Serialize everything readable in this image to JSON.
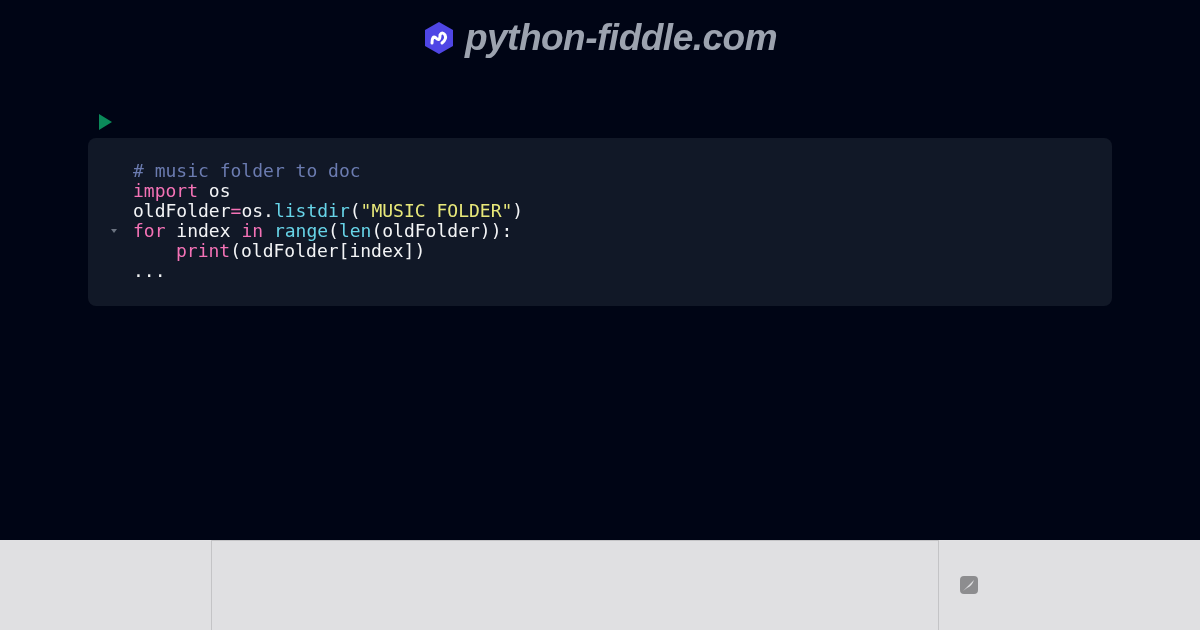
{
  "header": {
    "site_name": "python-fiddle.com"
  },
  "code": {
    "lines": [
      {
        "foldable": false,
        "indented": false,
        "tokens": [
          {
            "kind": "comment",
            "text": "# music folder to doc"
          }
        ]
      },
      {
        "foldable": false,
        "indented": false,
        "tokens": [
          {
            "kind": "keyword",
            "text": "import"
          },
          {
            "kind": "plain",
            "text": " os"
          }
        ]
      },
      {
        "foldable": false,
        "indented": false,
        "tokens": [
          {
            "kind": "plain",
            "text": "oldFolder"
          },
          {
            "kind": "operator",
            "text": "="
          },
          {
            "kind": "plain",
            "text": "os."
          },
          {
            "kind": "function",
            "text": "listdir"
          },
          {
            "kind": "plain",
            "text": "("
          },
          {
            "kind": "string",
            "text": "\"MUSIC FOLDER\""
          },
          {
            "kind": "plain",
            "text": ")"
          }
        ]
      },
      {
        "foldable": true,
        "indented": false,
        "tokens": [
          {
            "kind": "keyword",
            "text": "for"
          },
          {
            "kind": "plain",
            "text": " index "
          },
          {
            "kind": "keyword",
            "text": "in "
          },
          {
            "kind": "function",
            "text": "range"
          },
          {
            "kind": "plain",
            "text": "("
          },
          {
            "kind": "function",
            "text": "len"
          },
          {
            "kind": "plain",
            "text": "(oldFolder)):"
          }
        ]
      },
      {
        "foldable": false,
        "indented": true,
        "tokens": [
          {
            "kind": "keyword",
            "text": "print"
          },
          {
            "kind": "plain",
            "text": "(oldFolder[index])"
          }
        ]
      },
      {
        "foldable": false,
        "indented": false,
        "tokens": [
          {
            "kind": "plain",
            "text": "..."
          }
        ]
      }
    ]
  }
}
